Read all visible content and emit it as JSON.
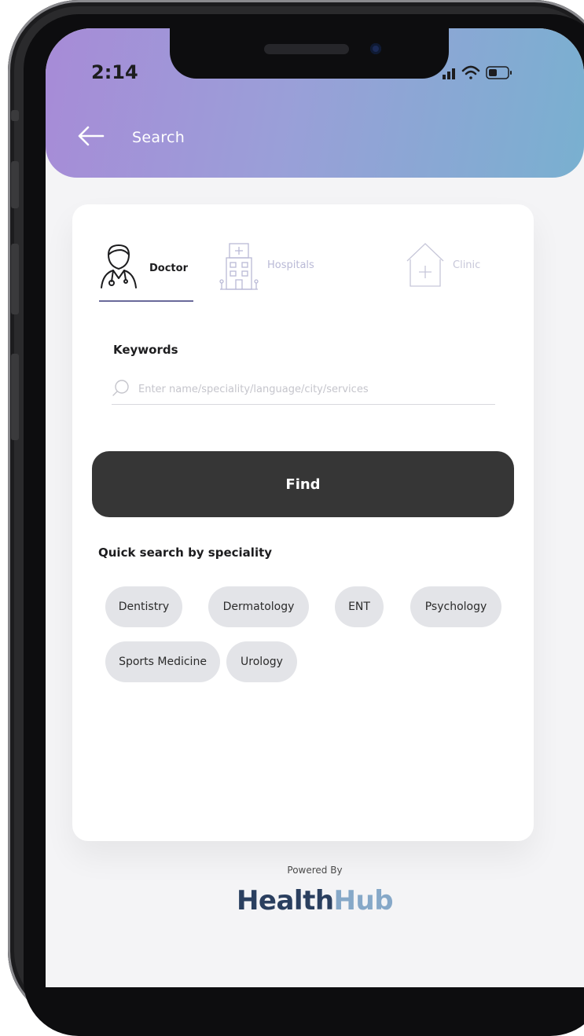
{
  "status_bar": {
    "time": "2:14"
  },
  "header": {
    "title": "Search"
  },
  "tabs": [
    {
      "label": "Doctor",
      "active": true,
      "icon": "doctor-icon"
    },
    {
      "label": "Hospitals",
      "active": false,
      "icon": "hospital-icon"
    },
    {
      "label": "Clinic",
      "active": false,
      "icon": "clinic-icon"
    }
  ],
  "search": {
    "label": "Keywords",
    "placeholder": "Enter name/speciality/language/city/services",
    "value": ""
  },
  "find_button": {
    "label": "Find"
  },
  "quick_search": {
    "title": "Quick search by speciality",
    "chips": [
      "Dentistry",
      "Dermatology",
      "ENT",
      "Psychology",
      "Sports Medicine",
      "Urology"
    ]
  },
  "footer": {
    "powered_by": "Powered By",
    "logo_part1": "Health",
    "logo_part2": "Hub"
  },
  "colors": {
    "header_gradient_start": "#a78bd7",
    "header_gradient_end": "#79b0d0",
    "button_dark": "#363636",
    "chip_bg": "#e3e4e8"
  }
}
